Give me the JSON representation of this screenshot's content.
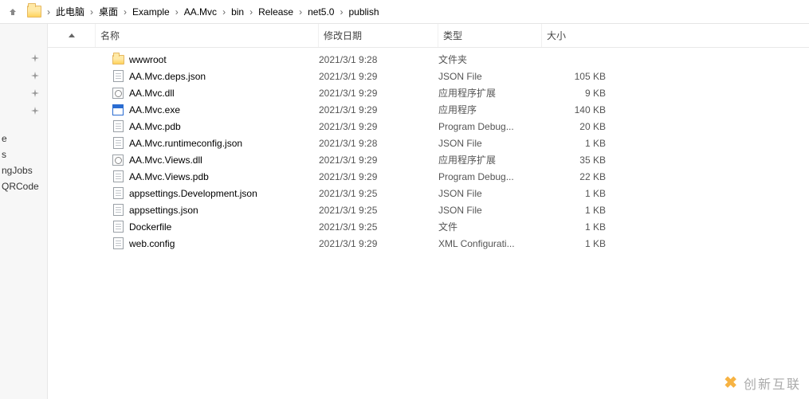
{
  "breadcrumb": [
    "此电脑",
    "桌面",
    "Example",
    "AA.Mvc",
    "bin",
    "Release",
    "net5.0",
    "publish"
  ],
  "columns": {
    "name": "名称",
    "date": "修改日期",
    "type": "类型",
    "size": "大小"
  },
  "sidebar": {
    "items": [
      "e",
      "s",
      "ngJobs",
      "QRCode"
    ]
  },
  "files": [
    {
      "icon": "folder",
      "name": "wwwroot",
      "date": "2021/3/1 9:28",
      "type": "文件夹",
      "size": ""
    },
    {
      "icon": "file",
      "name": "AA.Mvc.deps.json",
      "date": "2021/3/1 9:29",
      "type": "JSON File",
      "size": "105 KB"
    },
    {
      "icon": "dll",
      "name": "AA.Mvc.dll",
      "date": "2021/3/1 9:29",
      "type": "应用程序扩展",
      "size": "9 KB"
    },
    {
      "icon": "exe",
      "name": "AA.Mvc.exe",
      "date": "2021/3/1 9:29",
      "type": "应用程序",
      "size": "140 KB"
    },
    {
      "icon": "file",
      "name": "AA.Mvc.pdb",
      "date": "2021/3/1 9:29",
      "type": "Program Debug...",
      "size": "20 KB"
    },
    {
      "icon": "file",
      "name": "AA.Mvc.runtimeconfig.json",
      "date": "2021/3/1 9:28",
      "type": "JSON File",
      "size": "1 KB"
    },
    {
      "icon": "dll",
      "name": "AA.Mvc.Views.dll",
      "date": "2021/3/1 9:29",
      "type": "应用程序扩展",
      "size": "35 KB"
    },
    {
      "icon": "file",
      "name": "AA.Mvc.Views.pdb",
      "date": "2021/3/1 9:29",
      "type": "Program Debug...",
      "size": "22 KB"
    },
    {
      "icon": "file",
      "name": "appsettings.Development.json",
      "date": "2021/3/1 9:25",
      "type": "JSON File",
      "size": "1 KB"
    },
    {
      "icon": "file",
      "name": "appsettings.json",
      "date": "2021/3/1 9:25",
      "type": "JSON File",
      "size": "1 KB"
    },
    {
      "icon": "file",
      "name": "Dockerfile",
      "date": "2021/3/1 9:25",
      "type": "文件",
      "size": "1 KB"
    },
    {
      "icon": "file",
      "name": "web.config",
      "date": "2021/3/1 9:29",
      "type": "XML Configurati...",
      "size": "1 KB"
    }
  ],
  "watermark": "创新互联"
}
